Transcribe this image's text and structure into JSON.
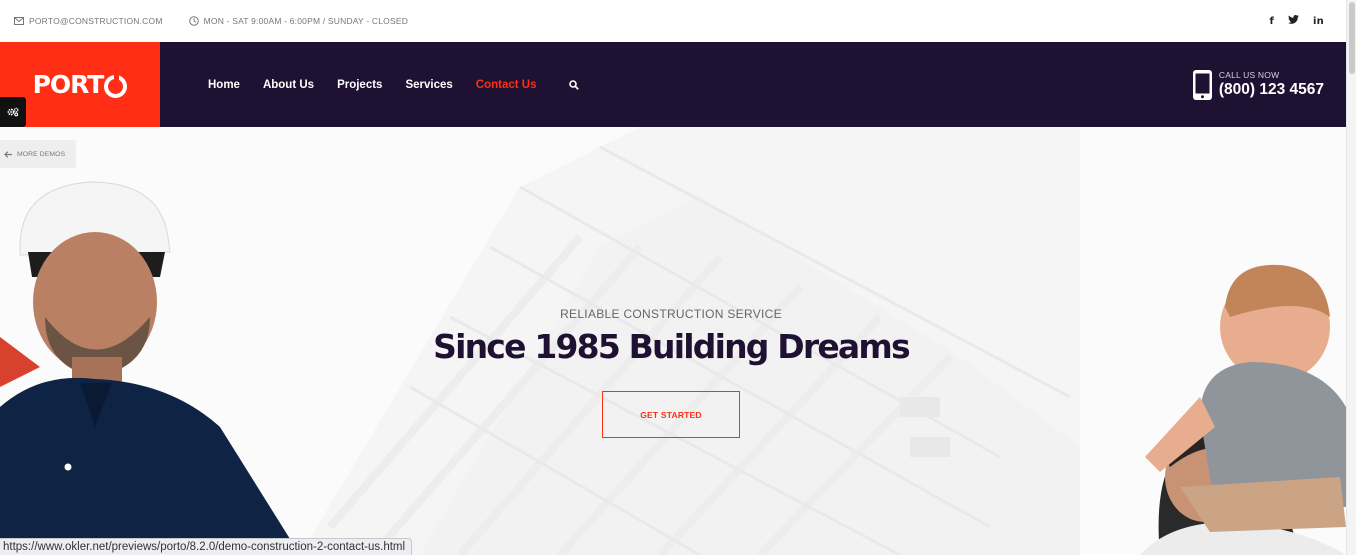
{
  "topbar": {
    "email": "PORTO@CONSTRUCTION.COM",
    "email_icon": "envelope-icon",
    "hours": "MON - SAT 9:00AM - 6:00PM / SUNDAY - CLOSED",
    "hours_icon": "clock-icon",
    "social": {
      "facebook": "f",
      "twitter": "twitter-bird-icon",
      "linkedin": "in"
    }
  },
  "header": {
    "logo_text": "PORT",
    "nav": {
      "home": "Home",
      "about": "About Us",
      "projects": "Projects",
      "services": "Services",
      "contact": "Contact Us"
    },
    "search_icon": "search-icon",
    "call_label": "CALL US NOW",
    "phone": "(800) 123 4567",
    "phone_icon": "smartphone-icon"
  },
  "sidebar": {
    "gear_icon": "gears-icon",
    "more_demos": "MORE DEMOS"
  },
  "hero": {
    "subtitle": "RELIABLE CONSTRUCTION SERVICE",
    "headline": "Since 1985 Building Dreams",
    "cta": "GET STARTED"
  },
  "statusbar": {
    "url": "https://www.okler.net/previews/porto/8.2.0/demo-construction-2-contact-us.html"
  },
  "colors": {
    "brand_red": "#ff2e14",
    "header_dark": "#1f1131",
    "hero_bg": "#fbfbfb"
  }
}
